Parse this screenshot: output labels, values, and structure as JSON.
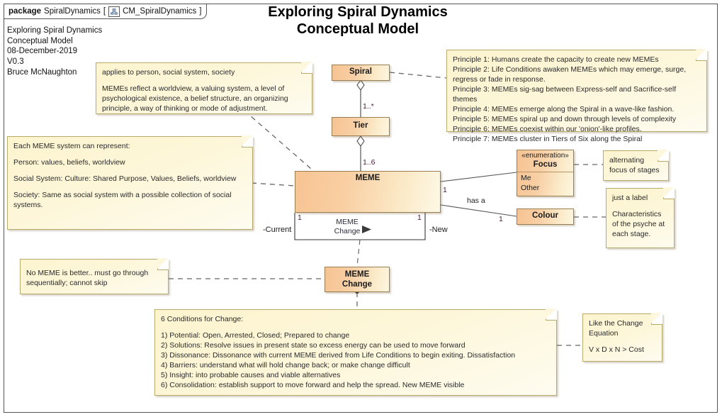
{
  "package": {
    "keyword": "package",
    "name": "SpiralDynamics",
    "bracket_open": "[",
    "icon": "class-diagram-icon",
    "diagram_name": "CM_SpiralDynamics",
    "bracket_close": "]"
  },
  "title": {
    "line1": "Exploring Spiral Dynamics",
    "line2": "Conceptual Model"
  },
  "meta": {
    "line1": "Exploring Spiral Dynamics",
    "line2": "Conceptual Model",
    "line3": "08-December-2019",
    "line4": "V0.3",
    "line5": "Bruce McNaughton"
  },
  "classes": {
    "spiral": {
      "name": "Spiral"
    },
    "tier": {
      "name": "Tier"
    },
    "meme": {
      "name": "MEME"
    },
    "focus": {
      "stereotype": "«enumeration»",
      "name": "Focus",
      "literals": [
        "Me",
        "Other"
      ]
    },
    "colour": {
      "name": "Colour"
    },
    "meme_change": {
      "name_line1": "MEME",
      "name_line2": "Change"
    }
  },
  "connectors": {
    "spiral_tier_mult": "1..*",
    "tier_meme_mult": "1..6",
    "meme_current_mult": "1",
    "meme_new_mult": "1",
    "meme_focus_mult": "1",
    "meme_colour_mult": "1",
    "role_current": "-Current",
    "role_new": "-New",
    "assoc_name_line1": "MEME",
    "assoc_name_line2": "Change",
    "has_a": "has a"
  },
  "notes": {
    "applies": {
      "p1": "applies to person, social system, society",
      "p2": "MEMEs reflect a worldview, a valuing system, a level of psychological existence, a belief structure, an organizing principle, a way of thinking or mode of adjustment."
    },
    "principles": {
      "lines": [
        "Principle 1:  Humans create the capacity to create new MEMEs",
        "Principle 2:  Life Conditions awaken MEMEs which may emerge, surge, regress or fade in response.",
        "Principle 3:  MEMEs sig-sag between Express-self and Sacrifice-self themes",
        "Principle 4:  MEMEs emerge along the Spiral in a wave-like fashion.",
        "Principle 5:  MEMEs spiral up and down through levels of complexity",
        "Principle 6:  MEMEs coexist within our 'onion'-like profiles.",
        "Principle 7:  MEMEs cluster in Tiers of Six along the Spiral"
      ]
    },
    "meme_system": {
      "p1": "Each MEME system can represent:",
      "p2": "Person:  values, beliefs, worldview",
      "p3": "Social System:  Culture:  Shared Purpose, Values, Beliefs, worldview",
      "p4": "Society:  Same as social system with a possible collection of social systems."
    },
    "alternating": {
      "p1": "alternating focus of stages"
    },
    "just_label": {
      "p1": "just a label",
      "p2": "Characteristics of the psyche at each stage."
    },
    "no_meme": {
      "p1": "No MEME is better.. must go through sequentially; cannot skip"
    },
    "conditions": {
      "heading": "6 Conditions for Change:",
      "lines": [
        "1) Potential:  Open, Arrested, Closed;  Prepared to change",
        "2) Solutions:  Resolve issues in present state so excess energy can be used to move forward",
        "3) Dissonance:  Dissonance with current MEME derived from Life Conditions to begin exiting. Dissatisfaction",
        "4) Barriers:  understand what will hold change back; or make change difficult",
        "5) Insight: into probable causes and viable alternatives",
        "6) Consolidation:  establish support to move forward and help the spread.  New MEME visible"
      ]
    },
    "change_equation": {
      "p1": "Like the Change Equation",
      "p2": "V x D x N > Cost"
    }
  },
  "colors": {
    "class_fill_start": "#f6c392",
    "class_fill_end": "#fdf6e0",
    "class_border": "#9a7e52",
    "note_fill": "#fdf4cf",
    "note_border": "#b9a96a",
    "connector": "#555555",
    "multiplicity_text": "#4a2040"
  }
}
